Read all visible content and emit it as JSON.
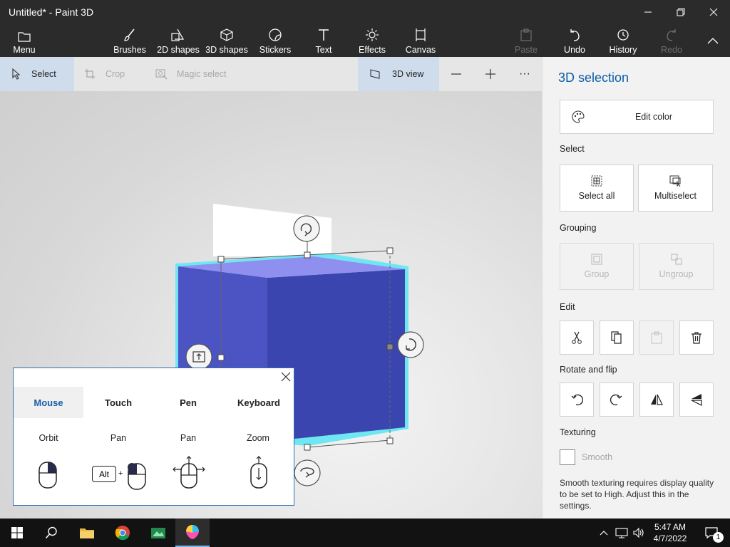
{
  "window": {
    "title": "Untitled* - Paint 3D"
  },
  "ribbon": {
    "menu": "Menu",
    "brushes": "Brushes",
    "shapes2d": "2D shapes",
    "shapes3d": "3D shapes",
    "stickers": "Stickers",
    "text": "Text",
    "effects": "Effects",
    "canvas": "Canvas",
    "paste": "Paste",
    "undo": "Undo",
    "history": "History",
    "redo": "Redo"
  },
  "toolbar": {
    "select": "Select",
    "crop": "Crop",
    "magic_select": "Magic select",
    "view3d": "3D view",
    "zoom_out": "—",
    "zoom_in": "+",
    "more": "···"
  },
  "panel": {
    "title": "3D selection",
    "edit_color": "Edit color",
    "select_label": "Select",
    "select_all": "Select all",
    "multiselect": "Multiselect",
    "grouping_label": "Grouping",
    "group": "Group",
    "ungroup": "Ungroup",
    "edit_label": "Edit",
    "rotate_label": "Rotate and flip",
    "texturing_label": "Texturing",
    "smooth": "Smooth",
    "note": "Smooth texturing requires display quality to be set to High. Adjust this in the settings."
  },
  "help_popup": {
    "tabs": [
      "Mouse",
      "Touch",
      "Pen",
      "Keyboard"
    ],
    "actions": [
      "Orbit",
      "Pan",
      "Pan",
      "Zoom"
    ],
    "alt_key": "Alt",
    "plus": "+"
  },
  "taskbar": {
    "time": "5:47 AM",
    "date": "4/7/2022",
    "notification_count": "1"
  },
  "colors": {
    "accent": "#0b5ea8",
    "cube_front": "#3b45b0",
    "cube_left": "#4c54c4",
    "cube_top": "#8f8ff0",
    "cube_glow": "#6fe6f2"
  }
}
